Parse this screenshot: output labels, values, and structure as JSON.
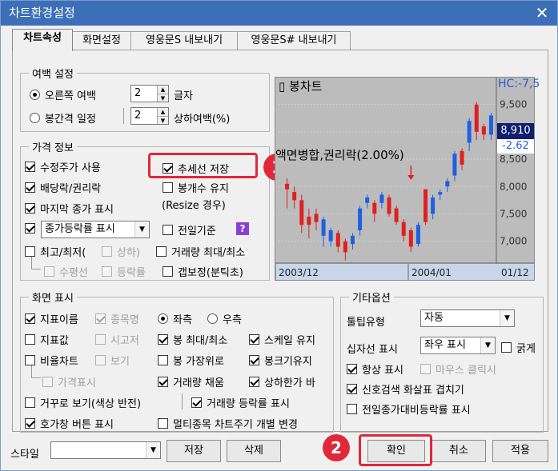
{
  "window": {
    "title": "차트환경설정",
    "close_glyph": "✕"
  },
  "tabs": [
    {
      "label": "차트속성"
    },
    {
      "label": "화면설정"
    },
    {
      "label": "영웅문S 내보내기"
    },
    {
      "label": "영웅문S# 내보내기"
    }
  ],
  "margin": {
    "title": "여백 설정",
    "right_margin_label": "오른쪽 여백",
    "right_margin_value": "2",
    "right_margin_unit": "글자",
    "interval_label": "봉간격 일정",
    "interval_value": "2",
    "interval_unit": "상하여백(%)"
  },
  "price": {
    "title": "가격 정보",
    "adj_price": "수정주가 사용",
    "trend_save": "추세선 저장",
    "dividend": "배당락/권리락",
    "keep_count": "봉개수 유지",
    "keep_count_note": "(Resize 경우)",
    "last_price": "마지막 종가 표시",
    "rate_combo": "종가등락률 표시",
    "prev_day": "전일기준",
    "help_glyph": "?",
    "highlow": "최고/최저(",
    "upper": "상하)",
    "vol_highlow": "거래량 최대/최소",
    "horizontal": "수평선",
    "rate": "등락률",
    "gap": "갭보정(분틱초)"
  },
  "preview": {
    "title": "봉차트",
    "annotation": "액면병합,권리락(2.00%)",
    "hc": "HC:-7,5",
    "price_box": "8,910",
    "change_box": "-2.62",
    "y_ticks": [
      "9,500",
      "9,000",
      "8,500",
      "8,000",
      "7,500",
      "7,000"
    ],
    "x_labels": [
      "2003/12",
      "2004/01",
      "01/12"
    ]
  },
  "screen": {
    "title": "화면 표시",
    "ind_name": "지표이름",
    "item_name": "종목명",
    "left": "좌측",
    "right": "우측",
    "ind_value": "지표값",
    "high_low_candle": "봉 최대/최소",
    "scale_keep": "스케일 유지",
    "fixed_view": "시고저",
    "ratio_chart": "비율차트",
    "view": "보기",
    "candle_top": "봉 가장위로",
    "candle_width": "봉크기유지",
    "price_view": "가격표시",
    "vol_fill": "거래량 채움",
    "limit_bar": "상하한가 바",
    "reverse": "거꾸로 보기(색상 반전)",
    "vol_rate": "거래량 등락률 표시",
    "quote_btn": "호가창 버튼 표시",
    "multi": "멀티종목 차트주기 개별 변경"
  },
  "misc": {
    "title": "기타옵션",
    "tooltip_label": "툴팁유형",
    "tooltip_value": "자동",
    "cross_label": "십자선 표시",
    "cross_value": "좌우 표시",
    "bold": "굵게",
    "always": "항상 표시",
    "mouse_click": "마우스 클릭시",
    "signal": "신호검색 화살표 겹치기",
    "prev_close": "전일종가대비등락률 표시"
  },
  "bottom": {
    "style_label": "스타일",
    "save": "저장",
    "delete": "삭제",
    "ok": "확인",
    "cancel": "취소",
    "apply": "적용"
  },
  "badges": [
    "1",
    "2"
  ],
  "chart_data": {
    "type": "candlestick",
    "up_color": "#e02020",
    "down_color": "#2060e0",
    "candles": [
      [
        1,
        8050,
        7950,
        7700,
        8150,
        7600
      ],
      [
        1,
        7900,
        7750,
        7650,
        8000,
        7600
      ],
      [
        1,
        7750,
        7300,
        7200,
        7850,
        7150
      ],
      [
        1,
        7300,
        7450,
        7250,
        7600,
        7050
      ],
      [
        1,
        7350,
        7500,
        7300,
        7600,
        7200
      ],
      [
        0,
        7400,
        7100,
        6900,
        7450,
        6900
      ],
      [
        0,
        7000,
        7200,
        6950,
        7250,
        6900
      ],
      [
        1,
        7150,
        6900,
        6850,
        7200,
        6800
      ],
      [
        1,
        7000,
        6800,
        6700,
        7050,
        6650
      ],
      [
        0,
        6950,
        7100,
        6900,
        7150,
        6850
      ],
      [
        0,
        7200,
        7600,
        7150,
        7650,
        7100
      ],
      [
        0,
        7700,
        7800,
        7650,
        7850,
        7600
      ],
      [
        1,
        7700,
        7500,
        7400,
        7750,
        7350
      ],
      [
        0,
        7700,
        7850,
        7650,
        7900,
        7600
      ],
      [
        1,
        7800,
        7500,
        7450,
        7850,
        7450
      ],
      [
        1,
        7600,
        7350,
        7300,
        7650,
        7300
      ],
      [
        1,
        7350,
        7100,
        7050,
        7400,
        7000
      ],
      [
        1,
        7200,
        6900,
        6850,
        7250,
        6800
      ],
      [
        0,
        6950,
        7300,
        6900,
        7350,
        6900
      ],
      [
        1,
        7950,
        7350,
        7300,
        7950,
        7300
      ],
      [
        0,
        7500,
        7800,
        7450,
        7850,
        7400
      ],
      [
        0,
        7900,
        7850,
        7800,
        7950,
        7750
      ],
      [
        0,
        8000,
        8100,
        7950,
        8150,
        7900
      ],
      [
        0,
        8200,
        8600,
        8150,
        8650,
        8100
      ],
      [
        1,
        8650,
        8400,
        8350,
        8700,
        8300
      ],
      [
        0,
        8800,
        9200,
        8700,
        9250,
        8650
      ],
      [
        1,
        9500,
        9000,
        8900,
        9550,
        8850
      ],
      [
        1,
        9100,
        8950,
        8900,
        9150,
        8850
      ],
      [
        0,
        8950,
        9300,
        8900,
        9350,
        8850
      ]
    ]
  }
}
